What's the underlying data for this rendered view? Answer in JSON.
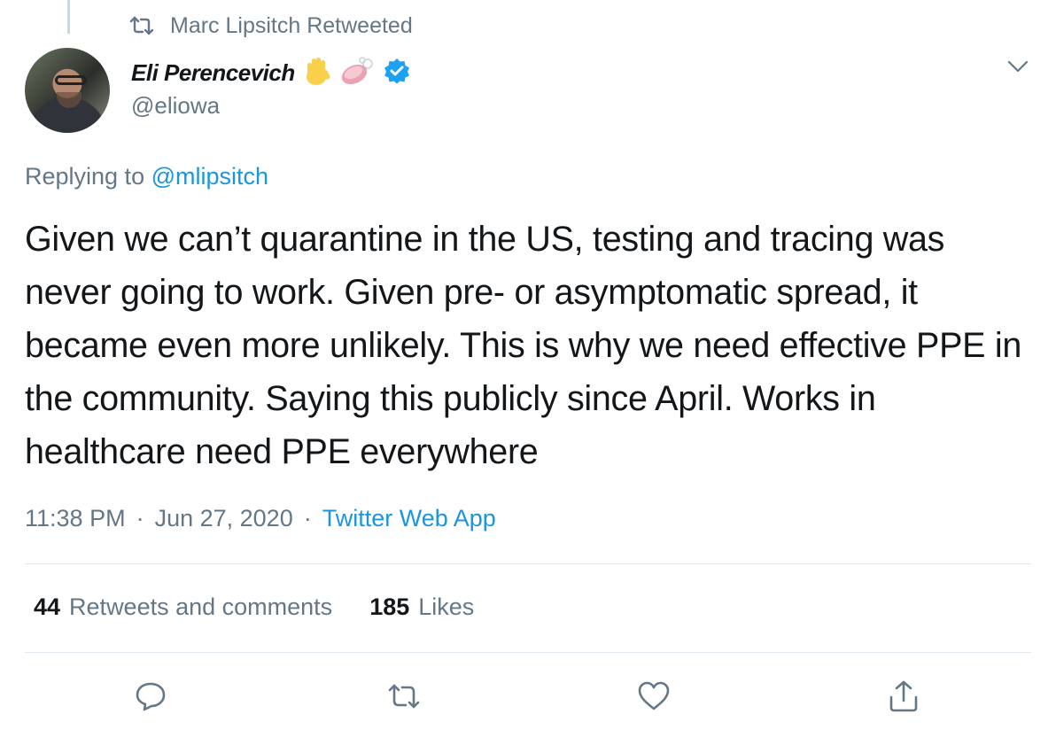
{
  "retweet_context": {
    "icon": "retweet-icon",
    "text": "Marc Lipsitch Retweeted"
  },
  "author": {
    "display_name": "Eli Perencevich",
    "handle": "@eliowa",
    "badges": [
      "raised-hand-emoji",
      "soap-emoji",
      "verified-badge-icon"
    ],
    "verified_color": "#1da1f2"
  },
  "reply": {
    "prefix": "Replying to",
    "mention": "@mlipsitch"
  },
  "tweet": {
    "text": "Given we can’t quarantine in the US, testing and tracing was never going to work. Given pre- or asymptomatic spread, it became even more unlikely. This is why we need effective PPE in the community. Saying this publicly since April. Works in healthcare need PPE everywhere"
  },
  "meta": {
    "time": "11:38 PM",
    "separator": "·",
    "date": "Jun 27, 2020",
    "source": "Twitter Web App"
  },
  "stats": {
    "retweets_count": "44",
    "retweets_label": "Retweets and comments",
    "likes_count": "185",
    "likes_label": "Likes"
  },
  "actions": [
    "reply-icon",
    "retweet-icon",
    "like-icon",
    "share-icon"
  ],
  "colors": {
    "text": "#14171a",
    "secondary": "#657786",
    "link": "#1b95e0",
    "divider": "#e1e8ed"
  }
}
